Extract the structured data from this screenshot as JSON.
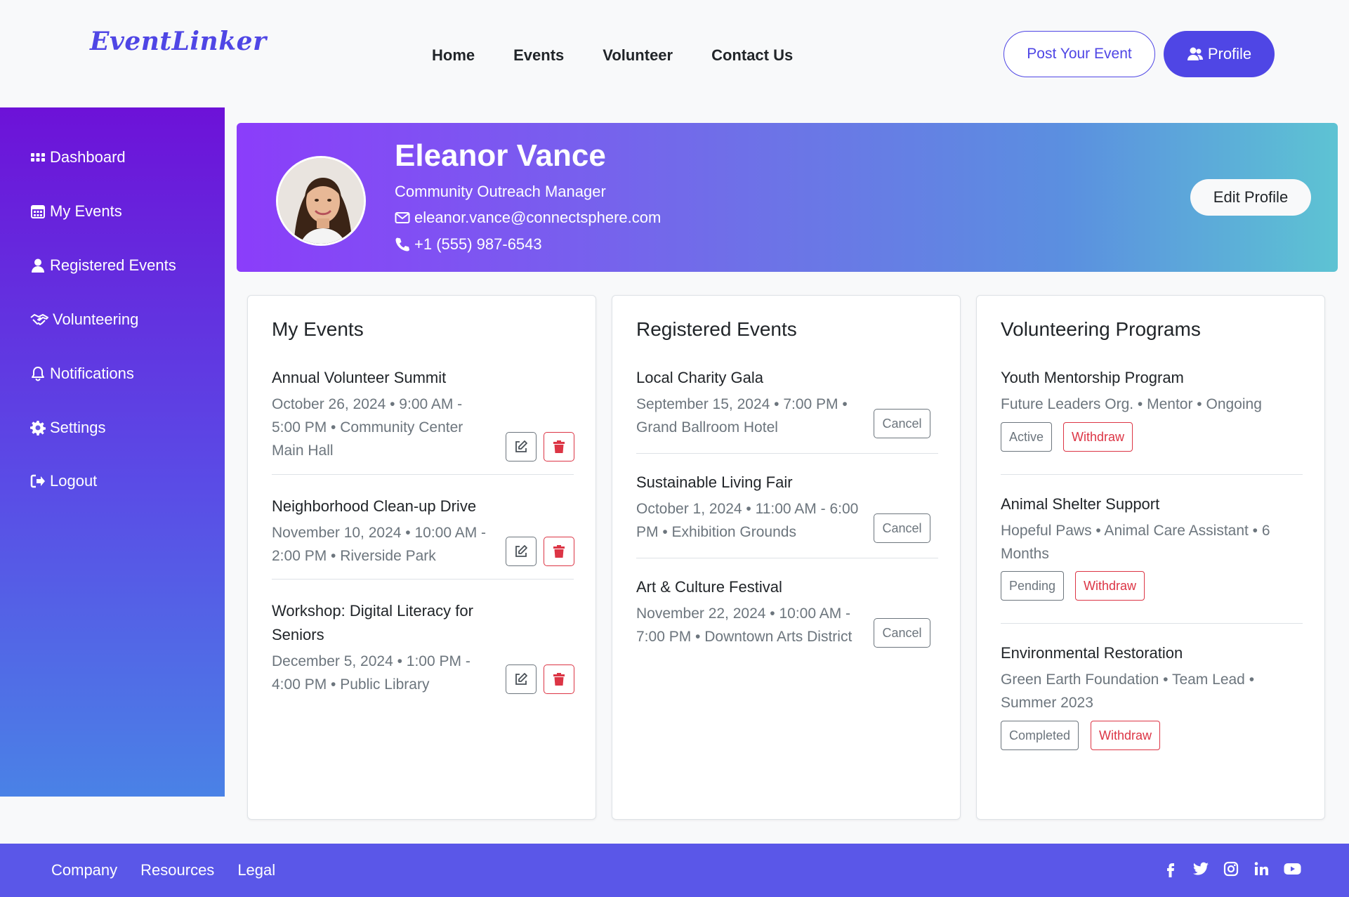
{
  "header": {
    "logo": "EventLinker",
    "nav": [
      "Home",
      "Events",
      "Volunteer",
      "Contact Us"
    ],
    "post_event": "Post Your Event",
    "profile": "Profile"
  },
  "sidebar": {
    "items": [
      {
        "label": "Dashboard",
        "icon": "grid-icon"
      },
      {
        "label": "My Events",
        "icon": "calendar-icon"
      },
      {
        "label": "Registered Events",
        "icon": "user-icon"
      },
      {
        "label": "Volunteering",
        "icon": "handshake-icon"
      },
      {
        "label": "Notifications",
        "icon": "bell-icon"
      },
      {
        "label": "Settings",
        "icon": "gear-icon"
      },
      {
        "label": "Logout",
        "icon": "logout-icon"
      }
    ]
  },
  "profile": {
    "name": "Eleanor Vance",
    "role": "Community Outreach Manager",
    "email": "eleanor.vance@connectsphere.com",
    "phone": "+1 (555) 987-6543",
    "edit_label": "Edit Profile"
  },
  "my_events": {
    "title": "My Events",
    "items": [
      {
        "title": "Annual Volunteer Summit",
        "meta_line1": "October 26, 2024 • 9:00 AM -",
        "meta_line2": "5:00 PM • Community Center",
        "meta_line3": "Main Hall"
      },
      {
        "title": "Neighborhood Clean-up Drive",
        "meta_line1": "November 10, 2024 • 10:00 AM -",
        "meta_line2": "2:00 PM • Riverside Park"
      },
      {
        "title_line1": "Workshop: Digital Literacy for",
        "title_line2": "Seniors",
        "meta_line1": "December 5, 2024 • 1:00 PM -",
        "meta_line2": "4:00 PM • Public Library"
      }
    ]
  },
  "registered_events": {
    "title": "Registered Events",
    "cancel_label": "Cancel",
    "items": [
      {
        "title": "Local Charity Gala",
        "meta_line1": "September 15, 2024 • 7:00 PM •",
        "meta_line2": "Grand Ballroom Hotel"
      },
      {
        "title": "Sustainable Living Fair",
        "meta_line1": "October 1, 2024 • 11:00 AM - 6:00",
        "meta_line2": "PM • Exhibition Grounds"
      },
      {
        "title": "Art & Culture Festival",
        "meta_line1": "November 22, 2024 • 10:00 AM -",
        "meta_line2": "7:00 PM • Downtown Arts District"
      }
    ]
  },
  "volunteering": {
    "title": "Volunteering Programs",
    "withdraw_label": "Withdraw",
    "items": [
      {
        "title": "Youth Mentorship Program",
        "meta_line1": "Future Leaders Org. • Mentor • Ongoing",
        "status": "Active"
      },
      {
        "title": "Animal Shelter Support",
        "meta_line1": "Hopeful Paws • Animal Care Assistant • 6",
        "meta_line2": "Months",
        "status": "Pending"
      },
      {
        "title": "Environmental Restoration",
        "meta_line1": "Green Earth Foundation • Team Lead •",
        "meta_line2": "Summer 2023",
        "status": "Completed"
      }
    ]
  },
  "footer": {
    "links": [
      "Company",
      "Resources",
      "Legal"
    ],
    "socials": [
      "facebook-icon",
      "twitter-icon",
      "instagram-icon",
      "linkedin-icon",
      "youtube-icon"
    ]
  },
  "colors": {
    "brand": "#4f46e5",
    "danger": "#dc3545",
    "muted": "#6c757d",
    "footer": "#5a57e8"
  }
}
